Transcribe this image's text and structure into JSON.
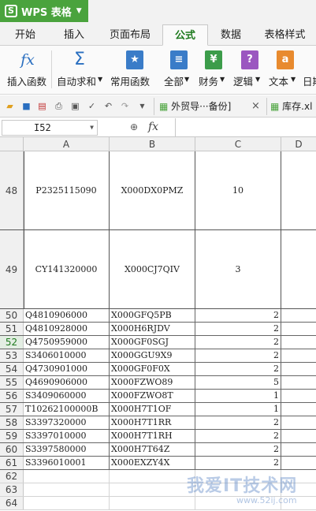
{
  "app": {
    "logo": "WPS 表格"
  },
  "tabs": [
    {
      "label": "开始",
      "active": false
    },
    {
      "label": "插入",
      "active": false
    },
    {
      "label": "页面布局",
      "active": false
    },
    {
      "label": "公式",
      "active": true
    },
    {
      "label": "数据",
      "active": false
    },
    {
      "label": "表格样式",
      "active": false
    }
  ],
  "ribbon": {
    "insert_function": "插入函数",
    "autosum": "自动求和",
    "common_functions": "常用函数",
    "all": "全部",
    "finance": "财务",
    "logic": "逻辑",
    "text": "文本",
    "datetime": "日期"
  },
  "doc_tabs": [
    {
      "label": "外贸导···备份]"
    },
    {
      "label": "库存.xl"
    }
  ],
  "formula_bar": {
    "cell_ref": "I52",
    "formula": ""
  },
  "columns": [
    "A",
    "B",
    "C",
    "D"
  ],
  "rows_big": [
    {
      "num": "48",
      "a": "P2325115090",
      "b": "X000DX0PMZ",
      "c": "10"
    },
    {
      "num": "49",
      "a": "CY141320000",
      "b": "X000CJ7QIV",
      "c": "3"
    }
  ],
  "rows": [
    {
      "num": "50",
      "a": "Q4810906000",
      "b": "X000GFQ5PB",
      "c": "2"
    },
    {
      "num": "51",
      "a": "Q4810928000",
      "b": "X000H6RJDV",
      "c": "2"
    },
    {
      "num": "52",
      "a": "Q4750959000",
      "b": "X000GF0SGJ",
      "c": "2"
    },
    {
      "num": "53",
      "a": "S3406010000",
      "b": "X000GGU9X9",
      "c": "2"
    },
    {
      "num": "54",
      "a": "Q4730901000",
      "b": "X000GF0F0X",
      "c": "2"
    },
    {
      "num": "55",
      "a": "Q4690906000",
      "b": "X000FZWO89",
      "c": "5"
    },
    {
      "num": "56",
      "a": "S3409060000",
      "b": "X000FZWO8T",
      "c": "1"
    },
    {
      "num": "57",
      "a": "T10262100000B",
      "b": "X000H7T1OF",
      "c": "1"
    },
    {
      "num": "58",
      "a": "S3397320000",
      "b": "X000H7T1RR",
      "c": "2"
    },
    {
      "num": "59",
      "a": "S3397010000",
      "b": "X000H7T1RH",
      "c": "2"
    },
    {
      "num": "60",
      "a": "S3397580000",
      "b": "X000H7T64Z",
      "c": "2"
    },
    {
      "num": "61",
      "a": "S3396010001",
      "b": "X000EXZY4X",
      "c": "2"
    },
    {
      "num": "62",
      "a": "",
      "b": "",
      "c": ""
    },
    {
      "num": "63",
      "a": "",
      "b": "",
      "c": ""
    },
    {
      "num": "64",
      "a": "",
      "b": "",
      "c": ""
    }
  ],
  "watermark": {
    "text": "我爱IT技术网",
    "url": "www.52ij.com"
  },
  "colors": {
    "brand": "#4aa33d",
    "active_tab": "#1e7a1e"
  }
}
